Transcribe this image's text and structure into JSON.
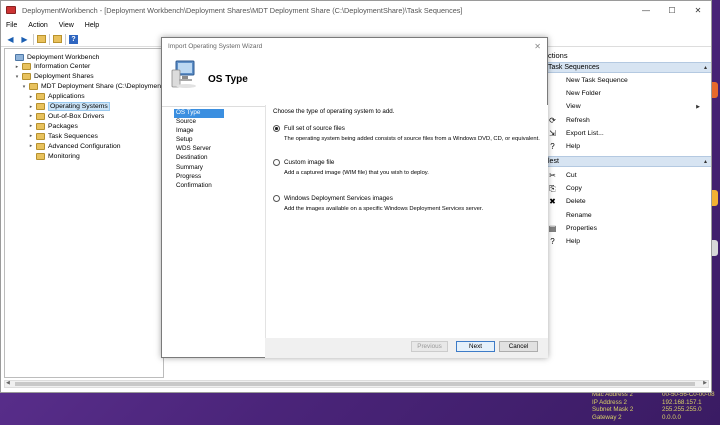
{
  "window": {
    "title": "DeploymentWorkbench - [Deployment Workbench\\Deployment Shares\\MDT Deployment Share (C:\\DeploymentShare)\\Task Sequences]",
    "controls": [
      "—",
      "☐",
      "✕"
    ]
  },
  "menu": [
    "File",
    "Action",
    "View",
    "Help"
  ],
  "tree": [
    {
      "label": "Deployment Workbench",
      "level": 0,
      "exp": "",
      "icon": "pc"
    },
    {
      "label": "Information Center",
      "level": 1,
      "exp": "▸",
      "icon": "folder"
    },
    {
      "label": "Deployment Shares",
      "level": 1,
      "exp": "▾",
      "icon": "folder"
    },
    {
      "label": "MDT Deployment Share (C:\\DeploymentSh",
      "level": 2,
      "exp": "▾",
      "icon": "share"
    },
    {
      "label": "Applications",
      "level": 3,
      "exp": "▸",
      "icon": "folder"
    },
    {
      "label": "Operating Systems",
      "level": 3,
      "exp": "▸",
      "icon": "folder",
      "selected": true
    },
    {
      "label": "Out-of-Box Drivers",
      "level": 3,
      "exp": "▸",
      "icon": "folder"
    },
    {
      "label": "Packages",
      "level": 3,
      "exp": "▸",
      "icon": "folder"
    },
    {
      "label": "Task Sequences",
      "level": 3,
      "exp": "▸",
      "icon": "folder"
    },
    {
      "label": "Advanced Configuration",
      "level": 3,
      "exp": "▸",
      "icon": "folder"
    },
    {
      "label": "Monitoring",
      "level": 3,
      "exp": "",
      "icon": "folder"
    }
  ],
  "actions": {
    "header": "ctions",
    "group1": "Task Sequences",
    "group1_items": [
      {
        "label": "New Task Sequence",
        "icon": "",
        "sub": false
      },
      {
        "label": "New Folder",
        "icon": "",
        "sub": false
      },
      {
        "label": "View",
        "icon": "",
        "sub": true
      },
      {
        "label": "Refresh",
        "icon": "⟳",
        "sub": false
      },
      {
        "label": "Export List...",
        "icon": "⇲",
        "sub": false
      },
      {
        "label": "Help",
        "icon": "?",
        "sub": false
      }
    ],
    "group2": "lest",
    "group2_items": [
      {
        "label": "Cut",
        "icon": "✂",
        "sub": false
      },
      {
        "label": "Copy",
        "icon": "⎘",
        "sub": false
      },
      {
        "label": "Delete",
        "icon": "✖",
        "sub": false
      },
      {
        "label": "Rename",
        "icon": "",
        "sub": false
      },
      {
        "label": "Properties",
        "icon": "▤",
        "sub": false
      },
      {
        "label": "Help",
        "icon": "?",
        "sub": false
      }
    ]
  },
  "wizard": {
    "title": "Import Operating System Wizard",
    "heading": "OS Type",
    "steps": [
      "OS Type",
      "Source",
      "Image",
      "Setup",
      "WDS Server",
      "Destination",
      "Summary",
      "Progress",
      "Confirmation"
    ],
    "prompt": "Choose the type of operating system to add.",
    "options": [
      {
        "label": "Full set of source files",
        "desc": "The operating system being added consists of source files from a Windows DVD, CD, or equivalent.",
        "selected": true
      },
      {
        "label": "Custom image file",
        "desc": "Add a captured image (WIM file) that you wish to deploy.",
        "selected": false
      },
      {
        "label": "Windows Deployment Services images",
        "desc": "Add the images available on a specific Windows Deployment Services server.",
        "selected": false
      }
    ],
    "buttons": {
      "previous": "Previous",
      "next": "Next",
      "cancel": "Cancel"
    }
  },
  "bginfo": [
    {
      "k": "Mac Address 2",
      "v": "00-50-56-C0-00-08"
    },
    {
      "k": "IP Address 2",
      "v": "192.168.157.1"
    },
    {
      "k": "Subnet Mask 2",
      "v": "255.255.255.0"
    },
    {
      "k": "Gateway 2",
      "v": "0.0.0.0"
    }
  ]
}
